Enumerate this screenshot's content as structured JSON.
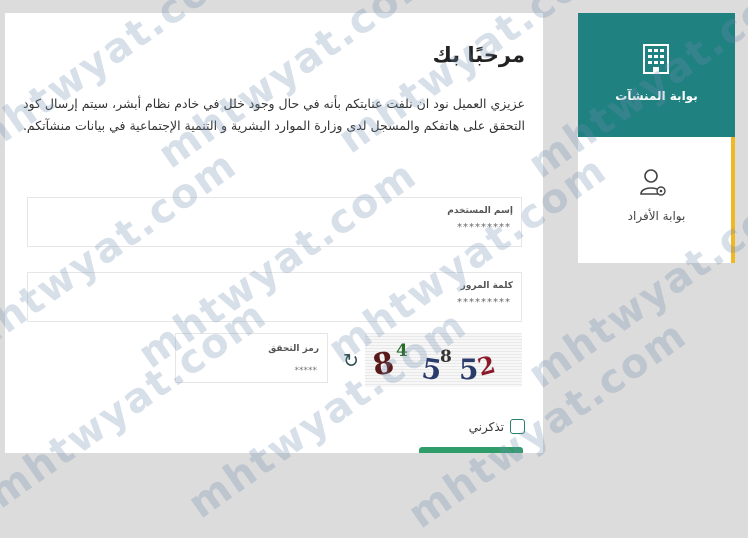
{
  "panel": {
    "title": "مرحبًا بك",
    "intro": "عزيزي العميل نود ان نلفت عنايتكم بأنه في حال وجود خلل في خادم نظام أبشر، سيتم إرسال كود التحقق على هاتفكم والمسجل لدى وزارة الموارد البشرية و التنمية الإجتماعية في بيانات منشآتكم."
  },
  "form": {
    "username": {
      "label": "إسم المستخدم",
      "value": "*********"
    },
    "password": {
      "label": "كلمة المرور",
      "value": "*********"
    },
    "captcha": {
      "label": "رمز التحقق",
      "value": "*****",
      "image_text": [
        "8",
        "4",
        "5",
        "8",
        "5",
        "2"
      ]
    },
    "remember_label": "تذكرني"
  },
  "sidebar": {
    "establishments_label": "بوابة المنشآت",
    "individuals_label": "بوابة الأفراد"
  },
  "watermark": {
    "text": "mhtwyat.com"
  },
  "colors": {
    "primary_teal": "#1f8280",
    "accent_yellow": "#f0b823",
    "button_green": "#2e9d6a"
  },
  "icons": [
    "building-icon",
    "user-settings-icon",
    "refresh-icon",
    "checkbox-icon"
  ]
}
